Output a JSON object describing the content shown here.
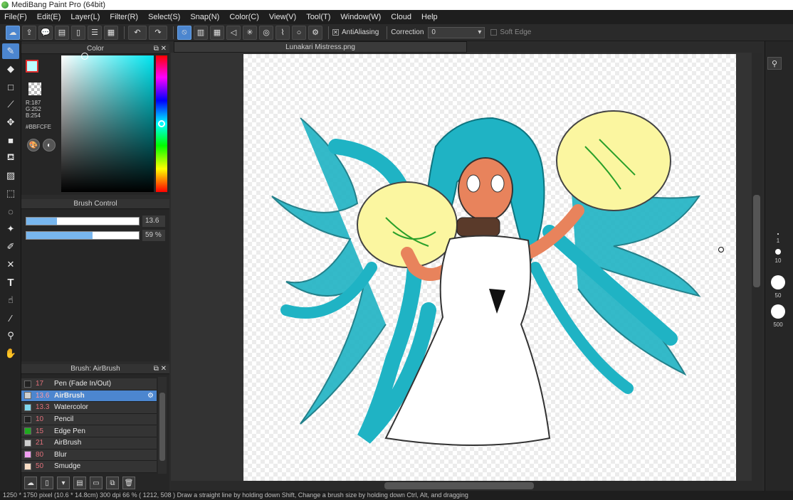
{
  "window": {
    "title": "MediBang Paint Pro (64bit)"
  },
  "menu": [
    "File(F)",
    "Edit(E)",
    "Layer(L)",
    "Filter(R)",
    "Select(S)",
    "Snap(N)",
    "Color(C)",
    "View(V)",
    "Tool(T)",
    "Window(W)",
    "Cloud",
    "Help"
  ],
  "toolbar": {
    "antialiasing_label": "AntiAliasing",
    "correction_label": "Correction",
    "correction_value": "0",
    "soft_edge_label": "Soft Edge"
  },
  "color_panel": {
    "title": "Color",
    "r": "R:187",
    "g": "G:252",
    "b": "B:254",
    "hex": "#BBFCFE",
    "current_color": "#BBFCFE"
  },
  "brush_control": {
    "title": "Brush Control",
    "size_value": "13.6",
    "size_fraction": 0.27,
    "opacity_value": "59 %",
    "opacity_fraction": 0.59
  },
  "brush_panel": {
    "title": "Brush: AirBrush",
    "brushes": [
      {
        "size": "17",
        "name": "Pen (Fade In/Out)",
        "color": "#222222",
        "selected": false
      },
      {
        "size": "13.6",
        "name": "AirBrush",
        "color": "#cfcfcf",
        "selected": true
      },
      {
        "size": "13.3",
        "name": "Watercolor",
        "color": "#7fd8ef",
        "selected": false
      },
      {
        "size": "10",
        "name": "Pencil",
        "color": "#222222",
        "selected": false
      },
      {
        "size": "15",
        "name": "Edge Pen",
        "color": "#1faa1f",
        "selected": false
      },
      {
        "size": "21",
        "name": "AirBrush",
        "color": "#cfcfcf",
        "selected": false
      },
      {
        "size": "80",
        "name": "Blur",
        "color": "#f09ef0",
        "selected": false
      },
      {
        "size": "50",
        "name": "Smudge",
        "color": "#f8dcc4",
        "selected": false
      }
    ]
  },
  "document": {
    "tab_title": "Lunakari Mistress.png"
  },
  "brush_sizes": [
    "1",
    "10",
    "50",
    "500"
  ],
  "statusbar": {
    "text": "1250 * 1750 pixel   (10.6 * 14.8cm)   300 dpi   66 %   ( 1212, 508 )   Draw a straight line by holding down Shift, Change a brush size by holding down Ctrl, Alt, and dragging"
  },
  "colors": {
    "accent": "#4c86cf",
    "teal": "#1fb3c4",
    "glow": "#fbf6a0"
  }
}
